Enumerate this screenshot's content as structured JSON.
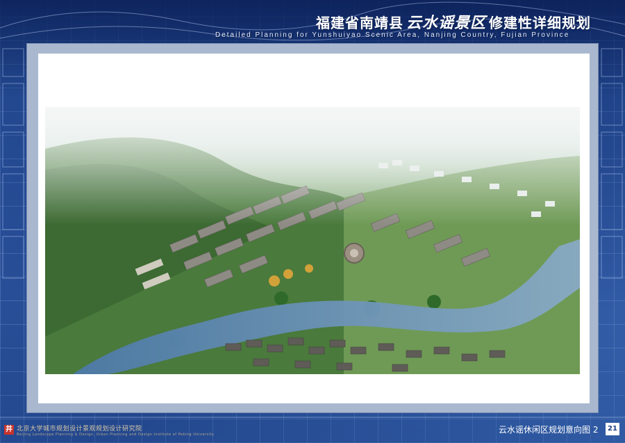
{
  "header": {
    "title_prefix": "福建省南靖县",
    "title_brand": "云水谣景区",
    "title_suffix": "修建性详细规划",
    "subtitle_en": "Detailed Planning for Yunshuiyao Scenic Area, Nanjing Country, Fujian Province"
  },
  "footer": {
    "org_cn": "北京大学城市规划设计景观规划设计研究院",
    "org_en": "Beijing Landscape Planning & Design, Urban Planning and Design Institute of Peking University",
    "caption": "云水谣休闲区规划意向图 2",
    "page_number": "21"
  },
  "colors": {
    "background": "#1d3f86",
    "frame": "#a9b8cf",
    "sheet": "#ffffff",
    "accent_red": "#c8342c"
  },
  "icons": {
    "logo": "institute-logo-icon"
  }
}
